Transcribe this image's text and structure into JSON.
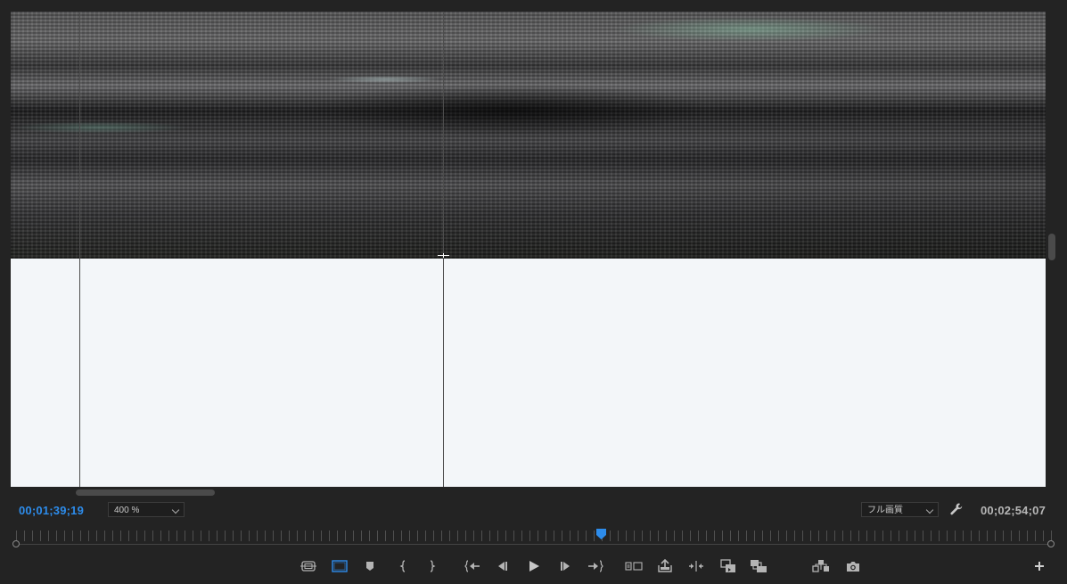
{
  "monitor": {
    "current_timecode": "00;01;39;19",
    "duration_timecode": "00;02;54;07",
    "zoom_level": "400 %",
    "playback_resolution": "フル画質",
    "playhead_position": 0.565
  },
  "colors": {
    "accent": "#2d8ceb",
    "panel_bg": "#232323",
    "frame_white": "#f3f6f9"
  },
  "transport": {
    "buttons": [
      {
        "name": "safe-margins-button",
        "icon": "safe-margins-icon"
      },
      {
        "name": "transparency-grid-button",
        "icon": "rectangle-icon",
        "active": true
      },
      {
        "name": "add-marker-button",
        "icon": "marker-icon"
      },
      {
        "name": "mark-in-button",
        "icon": "mark-in-icon"
      },
      {
        "name": "mark-out-button",
        "icon": "mark-out-icon"
      },
      {
        "name": "go-to-in-button",
        "icon": "go-to-in-icon"
      },
      {
        "name": "step-back-button",
        "icon": "step-back-icon"
      },
      {
        "name": "play-button",
        "icon": "play-icon"
      },
      {
        "name": "step-forward-button",
        "icon": "step-forward-icon"
      },
      {
        "name": "go-to-out-button",
        "icon": "go-to-out-icon"
      },
      {
        "name": "play-in-to-out-button",
        "icon": "in-out-icon"
      },
      {
        "name": "lift-button",
        "icon": "lift-icon"
      },
      {
        "name": "extract-button",
        "icon": "extract-icon"
      },
      {
        "name": "comparison-view-button",
        "icon": "comparison-icon"
      },
      {
        "name": "multicam-button",
        "icon": "multicam-icon"
      },
      {
        "name": "vr-button",
        "icon": "vr-icon"
      },
      {
        "name": "export-frame-button",
        "icon": "camera-icon"
      }
    ],
    "add_button_icon": "plus-icon"
  }
}
